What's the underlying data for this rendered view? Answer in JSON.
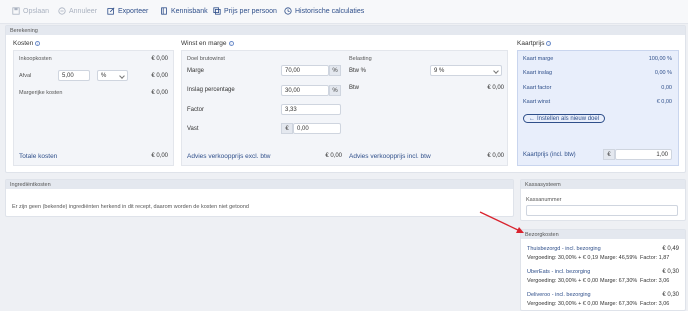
{
  "toolbar": {
    "save": "Opslaan",
    "cancel": "Annuleer",
    "export": "Exporteer",
    "knowledge": "Kennisbank",
    "price_per_person": "Prijs per persoon",
    "history": "Historische calculaties"
  },
  "berekening": {
    "header": "Berekening",
    "kosten": {
      "title": "Kosten",
      "inkoopkosten_label": "Inkoopkosten",
      "inkoopkosten_value": "€ 0,00",
      "afval_label": "Afval",
      "afval_input": "5,00",
      "afval_unit": "%",
      "afval_value": "€ 0,00",
      "margerijke_label": "Margerijke kosten",
      "margerijke_value": "€ 0,00",
      "totale_label": "Totale kosten",
      "totale_value": "€ 0,00"
    },
    "winst": {
      "title": "Winst en marge",
      "doel_label": "Doel brutowinst",
      "marge_label": "Marge",
      "marge_input": "70,00",
      "marge_unit": "%",
      "inslag_label": "Inslag percentage",
      "inslag_input": "30,00",
      "inslag_unit": "%",
      "factor_label": "Factor",
      "factor_input": "3,33",
      "vast_label": "Vast",
      "vast_currency": "€",
      "vast_input": "0,00",
      "belasting_label": "Belasting",
      "btw_pct_label": "Btw %",
      "btw_pct_value": "9 %",
      "btw_label": "Btw",
      "btw_value": "€ 0,00",
      "advies_excl_label": "Advies verkoopprijs excl. btw",
      "advies_excl_value": "€ 0,00",
      "advies_incl_label": "Advies verkoopprijs incl. btw",
      "advies_incl_value": "€ 0,00"
    },
    "kaartprijs": {
      "title": "Kaartprijs",
      "rows": [
        {
          "label": "Kaart marge",
          "value": "100,00 %"
        },
        {
          "label": "Kaart inslag",
          "value": "0,00 %"
        },
        {
          "label": "Kaart factor",
          "value": "0,00"
        },
        {
          "label": "Kaart winst",
          "value": "€ 0,00"
        }
      ],
      "button": "Instellen als nieuw doel",
      "price_label": "Kaartprijs (incl. btw)",
      "price_currency": "€",
      "price_input": "1,00"
    }
  },
  "ingredients": {
    "header": "Ingrediëntkosten",
    "message": "Er zijn geen (bekende) ingrediënten herkend in dit recept, daarom worden de kosten niet getoond"
  },
  "kassa": {
    "header": "Kassasysteem",
    "label": "Kassanummer",
    "input": ""
  },
  "bezorg": {
    "header": "Bezorgkosten",
    "items": [
      {
        "name": "Thuisbezorgd - incl. bezorging",
        "amount": "€ 0,49",
        "vergoeding": "Vergoeding: 30,00% + € 0,19",
        "marge": "Marge: 46,59%",
        "factor": "Factor: 1,87"
      },
      {
        "name": "UberEats - incl. bezorging",
        "amount": "€ 0,30",
        "vergoeding": "Vergoeding: 30,00% + € 0,00",
        "marge": "Marge: 67,30%",
        "factor": "Factor: 3,06"
      },
      {
        "name": "Deliveroo - incl. bezorging",
        "amount": "€ 0,30",
        "vergoeding": "Vergoeding: 30,00% + € 0,00",
        "marge": "Marge: 67,30%",
        "factor": "Factor: 3,06"
      }
    ]
  },
  "colors": {
    "accent": "#2f4f8a",
    "arrow": "#d9232e",
    "card_bg": "#e8eefb"
  }
}
